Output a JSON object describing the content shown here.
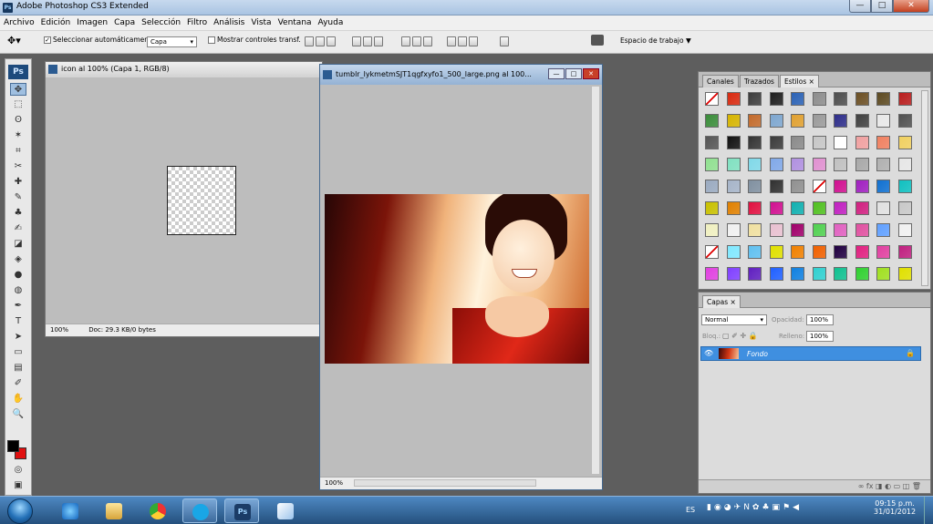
{
  "app": {
    "title": "Adobe Photoshop CS3 Extended",
    "logo": "Ps"
  },
  "window_controls": {
    "minimize": "—",
    "maximize": "□",
    "close": "✕"
  },
  "menu": [
    "Archivo",
    "Edición",
    "Imagen",
    "Capa",
    "Selección",
    "Filtro",
    "Análisis",
    "Vista",
    "Ventana",
    "Ayuda"
  ],
  "options": {
    "auto_select_label": "Seleccionar automáticamente:",
    "auto_select_checked": true,
    "auto_select_value": "Capa",
    "show_transform_label": "Mostrar controles transf.",
    "show_transform_checked": false,
    "workspace_label": "Espacio de trabajo ▼"
  },
  "toolbox": {
    "logo": "Ps",
    "tools": [
      "move-tool",
      "marquee-tool",
      "lasso-tool",
      "magic-wand-tool",
      "crop-tool",
      "slice-tool",
      "healing-brush-tool",
      "brush-tool",
      "clone-stamp-tool",
      "history-brush-tool",
      "eraser-tool",
      "paint-bucket-tool",
      "blur-tool",
      "dodge-tool",
      "pen-tool",
      "type-tool",
      "path-selection-tool",
      "shape-tool",
      "notes-tool",
      "eyedropper-tool",
      "hand-tool",
      "zoom-tool"
    ],
    "glyphs": [
      "✥",
      "⬚",
      "ʘ",
      "✶",
      "⌗",
      "✂",
      "✚",
      "✎",
      "♣",
      "✍",
      "◪",
      "◈",
      "●",
      "◍",
      "✒",
      "T",
      "➤",
      "▭",
      "▤",
      "✐",
      "✋",
      "🔍"
    ],
    "active_tool": 0,
    "foreground": "#000000",
    "background": "#e01010"
  },
  "doc1": {
    "title": "icon al 100% (Capa 1, RGB/8)",
    "zoom": "100%",
    "status": "Doc: 29.3 KB/0 bytes"
  },
  "doc2": {
    "title": "tumblr_lykmetmSJT1qgfxyfo1_500_large.png al 100...",
    "zoom": "100%"
  },
  "styles_panel": {
    "tabs": [
      "Canales",
      "Trazados",
      "Estilos ×"
    ],
    "active_tab": 2,
    "swatches": [
      "none",
      "#d82a10",
      "#3c3c3c",
      "#1e1e1e",
      "#2b62b5",
      "#8d8d8d",
      "#4d4d4d",
      "#6b4f24",
      "#5d4a22",
      "#b81d1d",
      "#3a8c3a",
      "#d6b400",
      "#c26a2b",
      "#7da6cf",
      "#e0a030",
      "#9a9a9a",
      "#2e2e8a",
      "#404040",
      "#e8e8e8",
      "#505050",
      "#555555",
      "#111111",
      "#333333",
      "#3b3b3b",
      "#8a8a8a",
      "#c6c6c6",
      "#ffffff",
      "#f0a0a0",
      "#f08060",
      "#f0d060",
      "#90e090",
      "#80e0c0",
      "#80d8e8",
      "#80a8e8",
      "#b090e0",
      "#e090d0",
      "#c0c0c0",
      "#a8a8a8",
      "#b0b0b0",
      "#e6e6e6",
      "#9aaac0",
      "#a6b4c8",
      "#8090a0",
      "#303030",
      "#909090",
      "none",
      "#d01090",
      "#a020c0",
      "#1070d0",
      "#10c0c0",
      "#c8c000",
      "#e08000",
      "#e01040",
      "#d01090",
      "#10b0b0",
      "#50c020",
      "#c020c0",
      "#d02080",
      "#e0e0e0",
      "#c8c8c8",
      "#f0f0c0",
      "#f0f0f0",
      "#f0e0a0",
      "#e8c0d0",
      "#a0006a",
      "#50d050",
      "#e060c0",
      "#e050a0",
      "#60a0ff",
      "#f0f0f0",
      "none",
      "#80e8ff",
      "#60c0f0",
      "#e0e000",
      "#f08000",
      "#f06000",
      "#200040",
      "#e02080",
      "#e040a0",
      "#c02080",
      "#e040e0",
      "#8040ff",
      "#6020c0",
      "#2060ff",
      "#1080e0",
      "#30d0d0",
      "#10c090",
      "#30d030",
      "#a0e020",
      "#e0e000"
    ]
  },
  "layers_panel": {
    "tab": "Capas ×",
    "blend_mode": "Normal",
    "opacity_label": "Opacidad:",
    "opacity": "100%",
    "lock_label": "Bloq.:",
    "fill_label": "Relleno:",
    "fill": "100%",
    "layer_name": "Fondo"
  },
  "taskbar": {
    "items": [
      "ie",
      "explorer",
      "chrome",
      "skype",
      "photoshop",
      "paint"
    ],
    "ps_label": "Ps",
    "lang": "ES",
    "time": "09:15 p.m.",
    "date": "31/01/2012"
  }
}
